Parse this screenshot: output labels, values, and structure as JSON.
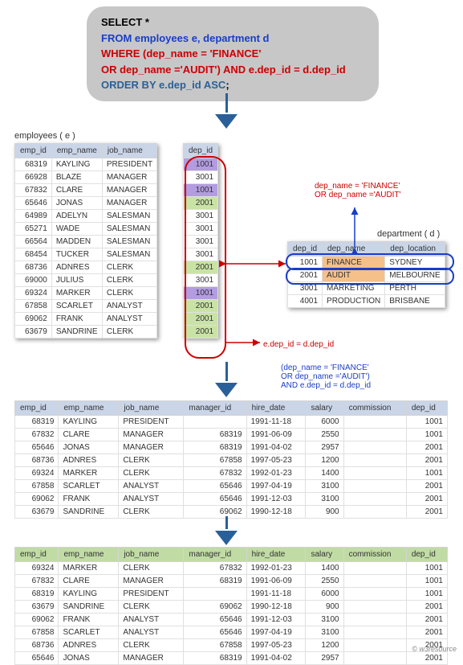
{
  "sql": {
    "select": "SELECT *",
    "from": "FROM employees e, department d",
    "where1": "WHERE (dep_name = 'FINANCE'",
    "where2": "OR dep_name ='AUDIT') AND e.dep_id = d.dep_id",
    "order": "ORDER BY e.dep_id ASC",
    "semi": ";"
  },
  "titles": {
    "employees": "employees ( e )",
    "department": "department ( d )"
  },
  "emp_cols": [
    "emp_id",
    "emp_name",
    "job_name"
  ],
  "emp_dep_col": "dep_id",
  "employees": [
    {
      "emp_id": 68319,
      "emp_name": "KAYLING",
      "job_name": "PRESIDENT",
      "dep_id": 1001,
      "hl": "purple"
    },
    {
      "emp_id": 66928,
      "emp_name": "BLAZE",
      "job_name": "MANAGER",
      "dep_id": 3001,
      "hl": ""
    },
    {
      "emp_id": 67832,
      "emp_name": "CLARE",
      "job_name": "MANAGER",
      "dep_id": 1001,
      "hl": "purple"
    },
    {
      "emp_id": 65646,
      "emp_name": "JONAS",
      "job_name": "MANAGER",
      "dep_id": 2001,
      "hl": "green"
    },
    {
      "emp_id": 64989,
      "emp_name": "ADELYN",
      "job_name": "SALESMAN",
      "dep_id": 3001,
      "hl": ""
    },
    {
      "emp_id": 65271,
      "emp_name": "WADE",
      "job_name": "SALESMAN",
      "dep_id": 3001,
      "hl": ""
    },
    {
      "emp_id": 66564,
      "emp_name": "MADDEN",
      "job_name": "SALESMAN",
      "dep_id": 3001,
      "hl": ""
    },
    {
      "emp_id": 68454,
      "emp_name": "TUCKER",
      "job_name": "SALESMAN",
      "dep_id": 3001,
      "hl": ""
    },
    {
      "emp_id": 68736,
      "emp_name": "ADNRES",
      "job_name": "CLERK",
      "dep_id": 2001,
      "hl": "green"
    },
    {
      "emp_id": 69000,
      "emp_name": "JULIUS",
      "job_name": "CLERK",
      "dep_id": 3001,
      "hl": ""
    },
    {
      "emp_id": 69324,
      "emp_name": "MARKER",
      "job_name": "CLERK",
      "dep_id": 1001,
      "hl": "purple"
    },
    {
      "emp_id": 67858,
      "emp_name": "SCARLET",
      "job_name": "ANALYST",
      "dep_id": 2001,
      "hl": "green"
    },
    {
      "emp_id": 69062,
      "emp_name": "FRANK",
      "job_name": "ANALYST",
      "dep_id": 2001,
      "hl": "green"
    },
    {
      "emp_id": 63679,
      "emp_name": "SANDRINE",
      "job_name": "CLERK",
      "dep_id": 2001,
      "hl": "green"
    }
  ],
  "dep_cols": [
    "dep_id",
    "dep_name",
    "dep_location"
  ],
  "department": [
    {
      "dep_id": 1001,
      "dep_name": "FINANCE",
      "dep_location": "SYDNEY",
      "hl": "orange"
    },
    {
      "dep_id": 2001,
      "dep_name": "AUDIT",
      "dep_location": "MELBOURNE",
      "hl": "orange"
    },
    {
      "dep_id": 3001,
      "dep_name": "MARKETING",
      "dep_location": "PERTH",
      "hl": ""
    },
    {
      "dep_id": 4001,
      "dep_name": "PRODUCTION",
      "dep_location": "BRISBANE",
      "hl": ""
    }
  ],
  "result_cols": [
    "emp_id",
    "emp_name",
    "job_name",
    "manager_id",
    "hire_date",
    "salary",
    "commission",
    "dep_id"
  ],
  "filtered": [
    {
      "emp_id": 68319,
      "emp_name": "KAYLING",
      "job_name": "PRESIDENT",
      "manager_id": "",
      "hire_date": "1991-11-18",
      "salary": 6000,
      "commission": "",
      "dep_id": 1001
    },
    {
      "emp_id": 67832,
      "emp_name": "CLARE",
      "job_name": "MANAGER",
      "manager_id": 68319,
      "hire_date": "1991-06-09",
      "salary": 2550,
      "commission": "",
      "dep_id": 1001
    },
    {
      "emp_id": 65646,
      "emp_name": "JONAS",
      "job_name": "MANAGER",
      "manager_id": 68319,
      "hire_date": "1991-04-02",
      "salary": 2957,
      "commission": "",
      "dep_id": 2001
    },
    {
      "emp_id": 68736,
      "emp_name": "ADNRES",
      "job_name": "CLERK",
      "manager_id": 67858,
      "hire_date": "1997-05-23",
      "salary": 1200,
      "commission": "",
      "dep_id": 2001
    },
    {
      "emp_id": 69324,
      "emp_name": "MARKER",
      "job_name": "CLERK",
      "manager_id": 67832,
      "hire_date": "1992-01-23",
      "salary": 1400,
      "commission": "",
      "dep_id": 1001
    },
    {
      "emp_id": 67858,
      "emp_name": "SCARLET",
      "job_name": "ANALYST",
      "manager_id": 65646,
      "hire_date": "1997-04-19",
      "salary": 3100,
      "commission": "",
      "dep_id": 2001
    },
    {
      "emp_id": 69062,
      "emp_name": "FRANK",
      "job_name": "ANALYST",
      "manager_id": 65646,
      "hire_date": "1991-12-03",
      "salary": 3100,
      "commission": "",
      "dep_id": 2001
    },
    {
      "emp_id": 63679,
      "emp_name": "SANDRINE",
      "job_name": "CLERK",
      "manager_id": 69062,
      "hire_date": "1990-12-18",
      "salary": 900,
      "commission": "",
      "dep_id": 2001
    }
  ],
  "ordered": [
    {
      "emp_id": 69324,
      "emp_name": "MARKER",
      "job_name": "CLERK",
      "manager_id": 67832,
      "hire_date": "1992-01-23",
      "salary": 1400,
      "commission": "",
      "dep_id": 1001
    },
    {
      "emp_id": 67832,
      "emp_name": "CLARE",
      "job_name": "MANAGER",
      "manager_id": 68319,
      "hire_date": "1991-06-09",
      "salary": 2550,
      "commission": "",
      "dep_id": 1001
    },
    {
      "emp_id": 68319,
      "emp_name": "KAYLING",
      "job_name": "PRESIDENT",
      "manager_id": "",
      "hire_date": "1991-11-18",
      "salary": 6000,
      "commission": "",
      "dep_id": 1001
    },
    {
      "emp_id": 63679,
      "emp_name": "SANDRINE",
      "job_name": "CLERK",
      "manager_id": 69062,
      "hire_date": "1990-12-18",
      "salary": 900,
      "commission": "",
      "dep_id": 2001
    },
    {
      "emp_id": 69062,
      "emp_name": "FRANK",
      "job_name": "ANALYST",
      "manager_id": 65646,
      "hire_date": "1991-12-03",
      "salary": 3100,
      "commission": "",
      "dep_id": 2001
    },
    {
      "emp_id": 67858,
      "emp_name": "SCARLET",
      "job_name": "ANALYST",
      "manager_id": 65646,
      "hire_date": "1997-04-19",
      "salary": 3100,
      "commission": "",
      "dep_id": 2001
    },
    {
      "emp_id": 68736,
      "emp_name": "ADNRES",
      "job_name": "CLERK",
      "manager_id": 67858,
      "hire_date": "1997-05-23",
      "salary": 1200,
      "commission": "",
      "dep_id": 2001
    },
    {
      "emp_id": 65646,
      "emp_name": "JONAS",
      "job_name": "MANAGER",
      "manager_id": 68319,
      "hire_date": "1991-04-02",
      "salary": 2957,
      "commission": "",
      "dep_id": 2001
    }
  ],
  "annot": {
    "where_label1": "dep_name = 'FINANCE'",
    "where_label2": "OR dep_name ='AUDIT'",
    "join_label": "e.dep_id = d.dep_id",
    "combo1": "(dep_name = 'FINANCE'",
    "combo2": "OR dep_name ='AUDIT')",
    "combo3": "AND e.dep_id = d.dep_id"
  },
  "footer": "© w3resource"
}
